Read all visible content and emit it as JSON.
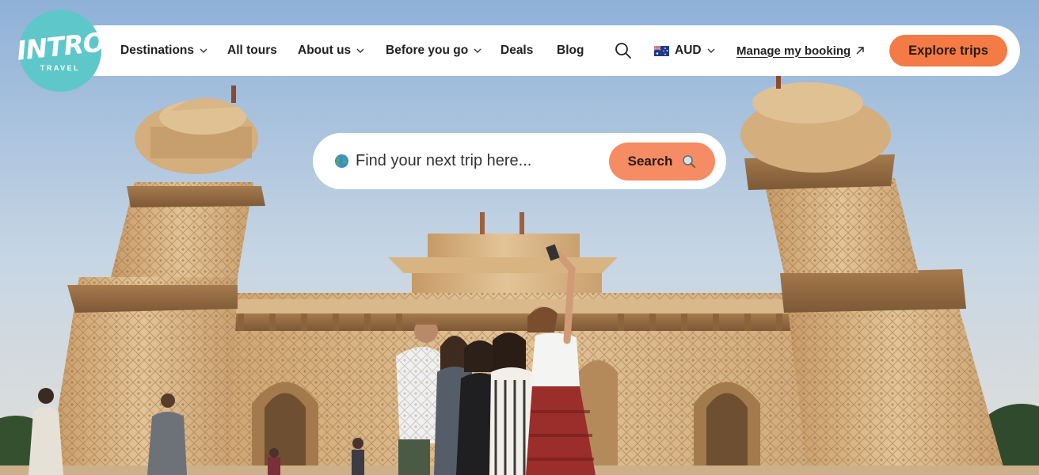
{
  "brand": {
    "logo_word": "INTRO",
    "logo_sub": "TRAVEL",
    "color": "#5ec7c9"
  },
  "nav": {
    "items": [
      {
        "label": "Destinations",
        "dropdown": true
      },
      {
        "label": "All tours",
        "dropdown": false
      },
      {
        "label": "About us",
        "dropdown": true
      },
      {
        "label": "Before you go",
        "dropdown": true
      },
      {
        "label": "Deals",
        "dropdown": false
      },
      {
        "label": "Blog",
        "dropdown": false
      }
    ],
    "search_icon": "search-icon",
    "currency": {
      "flag": "australia-flag",
      "label": "AUD"
    },
    "manage_booking": "Manage my booking",
    "cta": "Explore trips",
    "cta_color": "#f47b45"
  },
  "search": {
    "icon": "globe-icon",
    "placeholder": "Find your next trip here...",
    "button": "Search",
    "button_color": "#f58c64"
  },
  "hero": {
    "subject": "Travelers taking a selfie in front of an ornate marble mausoleum"
  }
}
